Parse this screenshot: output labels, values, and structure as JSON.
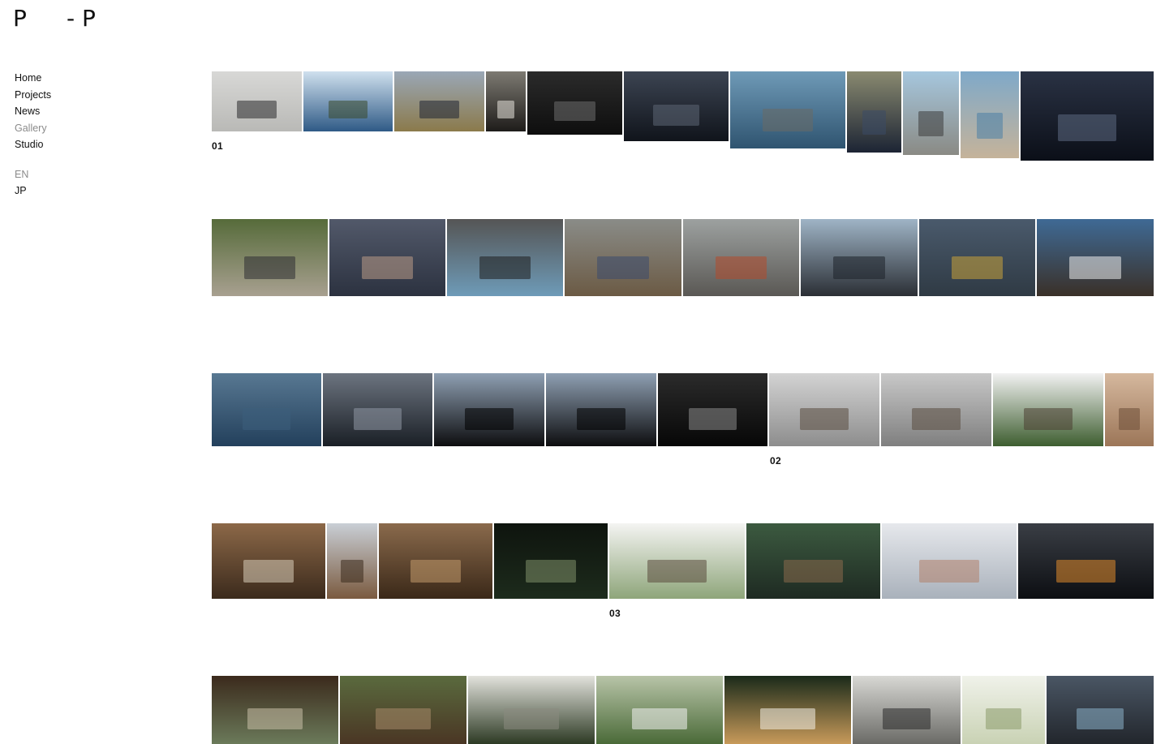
{
  "logo": {
    "left": "P",
    "right": "- P"
  },
  "nav": {
    "items": [
      "Home",
      "Projects",
      "News",
      "Gallery",
      "Studio"
    ],
    "active": "Gallery"
  },
  "languages": [
    "EN",
    "JP"
  ],
  "captions": [
    "01",
    "02",
    "03"
  ],
  "gallery": {
    "row1": [
      {
        "name": "charcoal-cube-photo",
        "colors": [
          "#d8d8d6",
          "#b9b9b6"
        ],
        "accent": "#2a2a2c"
      },
      {
        "name": "bay-islands-photo",
        "colors": [
          "#cfe0ee",
          "#2f5a86"
        ],
        "accent": "#3a4a2c"
      },
      {
        "name": "charcoal-bench-field-photo",
        "colors": [
          "#9aa7b6",
          "#8b7a4b"
        ],
        "accent": "#1f2533"
      },
      {
        "name": "interior-window-photo",
        "colors": [
          "#7d7a72",
          "#1e1c1a"
        ],
        "accent": "#e8e4dc"
      },
      {
        "name": "dark-table-photo",
        "colors": [
          "#2b2b2b",
          "#0e0e0e"
        ],
        "accent": "#6d6d6d"
      },
      {
        "name": "dark-water-photo",
        "colors": [
          "#3c4452",
          "#10141b"
        ],
        "accent": "#5c6675"
      },
      {
        "name": "bench-in-shallows-photo",
        "colors": [
          "#6f9ab7",
          "#2f5470"
        ],
        "accent": "#6a6a64"
      },
      {
        "name": "oyster-pile-photo",
        "colors": [
          "#8a8a70",
          "#1c2434"
        ],
        "accent": "#3a4a66"
      },
      {
        "name": "bench-shore-photo",
        "colors": [
          "#a6c7de",
          "#8a8a84"
        ],
        "accent": "#3d3d3d"
      },
      {
        "name": "sea-beach-photo",
        "colors": [
          "#7fa9c9",
          "#c5b39a"
        ],
        "accent": "#4a7fa5"
      },
      {
        "name": "oyster-shells-closeup-photo",
        "colors": [
          "#2a3244",
          "#0b0f18"
        ],
        "accent": "#5c6a82"
      }
    ],
    "row2": [
      {
        "name": "shell-pile-hillside-photo",
        "colors": [
          "#566b3a",
          "#a8a090"
        ],
        "accent": "#2d2d33"
      },
      {
        "name": "hands-wire-photo",
        "colors": [
          "#52596a",
          "#2c3240"
        ],
        "accent": "#b99a86"
      },
      {
        "name": "charcoal-crate-photo",
        "colors": [
          "#555",
          "#6e9bb8"
        ],
        "accent": "#1d1d1d"
      },
      {
        "name": "worker-table-photo",
        "colors": [
          "#8a8c88",
          "#6b5a44"
        ],
        "accent": "#3b4a6e"
      },
      {
        "name": "workshop-machine-photo",
        "colors": [
          "#9da1a0",
          "#5a5854"
        ],
        "accent": "#b24a2c"
      },
      {
        "name": "oyster-raft-worker-photo",
        "colors": [
          "#9fb4c6",
          "#2b2f35"
        ],
        "accent": "#1d2229"
      },
      {
        "name": "bamboo-raft-gloves-photo",
        "colors": [
          "#4a5a6c",
          "#2f3a44"
        ],
        "accent": "#c8a23a"
      },
      {
        "name": "harbor-boat-photo",
        "colors": [
          "#3f6a95",
          "#3a3028"
        ],
        "accent": "#efefef"
      }
    ],
    "row3": [
      {
        "name": "calm-sea-photo",
        "colors": [
          "#587892",
          "#23405c"
        ],
        "accent": "#3d5f7b"
      },
      {
        "name": "ripple-water-photo",
        "colors": [
          "#6c7480",
          "#1a1f26"
        ],
        "accent": "#8f98a4"
      },
      {
        "name": "water-bench-frame-photo",
        "colors": [
          "#8fa0b3",
          "#0d0d0f"
        ],
        "accent": "#000000"
      },
      {
        "name": "water-bench-frame-2-photo",
        "colors": [
          "#8fa0b3",
          "#0d0d0f"
        ],
        "accent": "#000000"
      },
      {
        "name": "dark-sculpture-photo",
        "colors": [
          "#2b2b2b",
          "#070707"
        ],
        "accent": "#8a8a8a"
      },
      {
        "name": "snow-forest-cabin-photo",
        "colors": [
          "#d3d3d3",
          "#8d8d8d"
        ],
        "accent": "#5a4d40"
      },
      {
        "name": "snow-forest-cabin-2-photo",
        "colors": [
          "#c8c8c8",
          "#7f7f7f"
        ],
        "accent": "#5a4d40"
      },
      {
        "name": "green-forest-cabin-photo",
        "colors": [
          "#f2f2f2",
          "#3e5e30"
        ],
        "accent": "#4d3f33"
      },
      {
        "name": "wood-interior-strip-photo",
        "colors": [
          "#d5b89e",
          "#9c7658"
        ],
        "accent": "#6b4c36"
      }
    ],
    "row4": [
      {
        "name": "wood-room-photo",
        "colors": [
          "#8c6848",
          "#3b2a1c"
        ],
        "accent": "#d8cdb9"
      },
      {
        "name": "wood-angle-photo",
        "colors": [
          "#c9cfd6",
          "#7a5a3f"
        ],
        "accent": "#3a2a1c"
      },
      {
        "name": "sauna-interior-photo",
        "colors": [
          "#8a6a4c",
          "#3a2818"
        ],
        "accent": "#c29a6c"
      },
      {
        "name": "night-forest-photo",
        "colors": [
          "#0e140e",
          "#1d2b1c"
        ],
        "accent": "#7f8f6a"
      },
      {
        "name": "white-field-cabin-photo",
        "colors": [
          "#f4f4f2",
          "#8ea57a"
        ],
        "accent": "#5a4a3c"
      },
      {
        "name": "glass-house-deck-photo",
        "colors": [
          "#3c5a40",
          "#1e2a22"
        ],
        "accent": "#8a6a4c"
      },
      {
        "name": "snow-pavilion-render-photo",
        "colors": [
          "#e6e8ec",
          "#a9b1bb"
        ],
        "accent": "#b0806a"
      },
      {
        "name": "snow-night-fireplace-photo",
        "colors": [
          "#3a3e45",
          "#0c0e12"
        ],
        "accent": "#e08a2c"
      }
    ],
    "row5": [
      {
        "name": "open-pavilion-photo",
        "colors": [
          "#3b2a1c",
          "#6b7a5a"
        ],
        "accent": "#c8c0a8"
      },
      {
        "name": "wood-pavilion-forest-photo",
        "colors": [
          "#5a6a3e",
          "#4a3624"
        ],
        "accent": "#a88a6a"
      },
      {
        "name": "pavilion-roof-photo",
        "colors": [
          "#e2e2dc",
          "#2d3a24"
        ],
        "accent": "#8a8a80"
      },
      {
        "name": "white-roof-forest-photo",
        "colors": [
          "#b8c4a8",
          "#4a6a38"
        ],
        "accent": "#f2f2f2"
      },
      {
        "name": "night-roof-forest-photo",
        "colors": [
          "#1a2a1a",
          "#c89a5a"
        ],
        "accent": "#f4f0e8"
      },
      {
        "name": "old-building-photo",
        "colors": [
          "#d8d8d4",
          "#6a6a66"
        ],
        "accent": "#2a2a2a"
      },
      {
        "name": "tree-sketch-render-photo",
        "colors": [
          "#f0f2ea",
          "#c9d2b4"
        ],
        "accent": "#8a9a6a"
      },
      {
        "name": "library-stacks-photo",
        "colors": [
          "#4a5664",
          "#22262c"
        ],
        "accent": "#8ab0c8"
      }
    ]
  }
}
